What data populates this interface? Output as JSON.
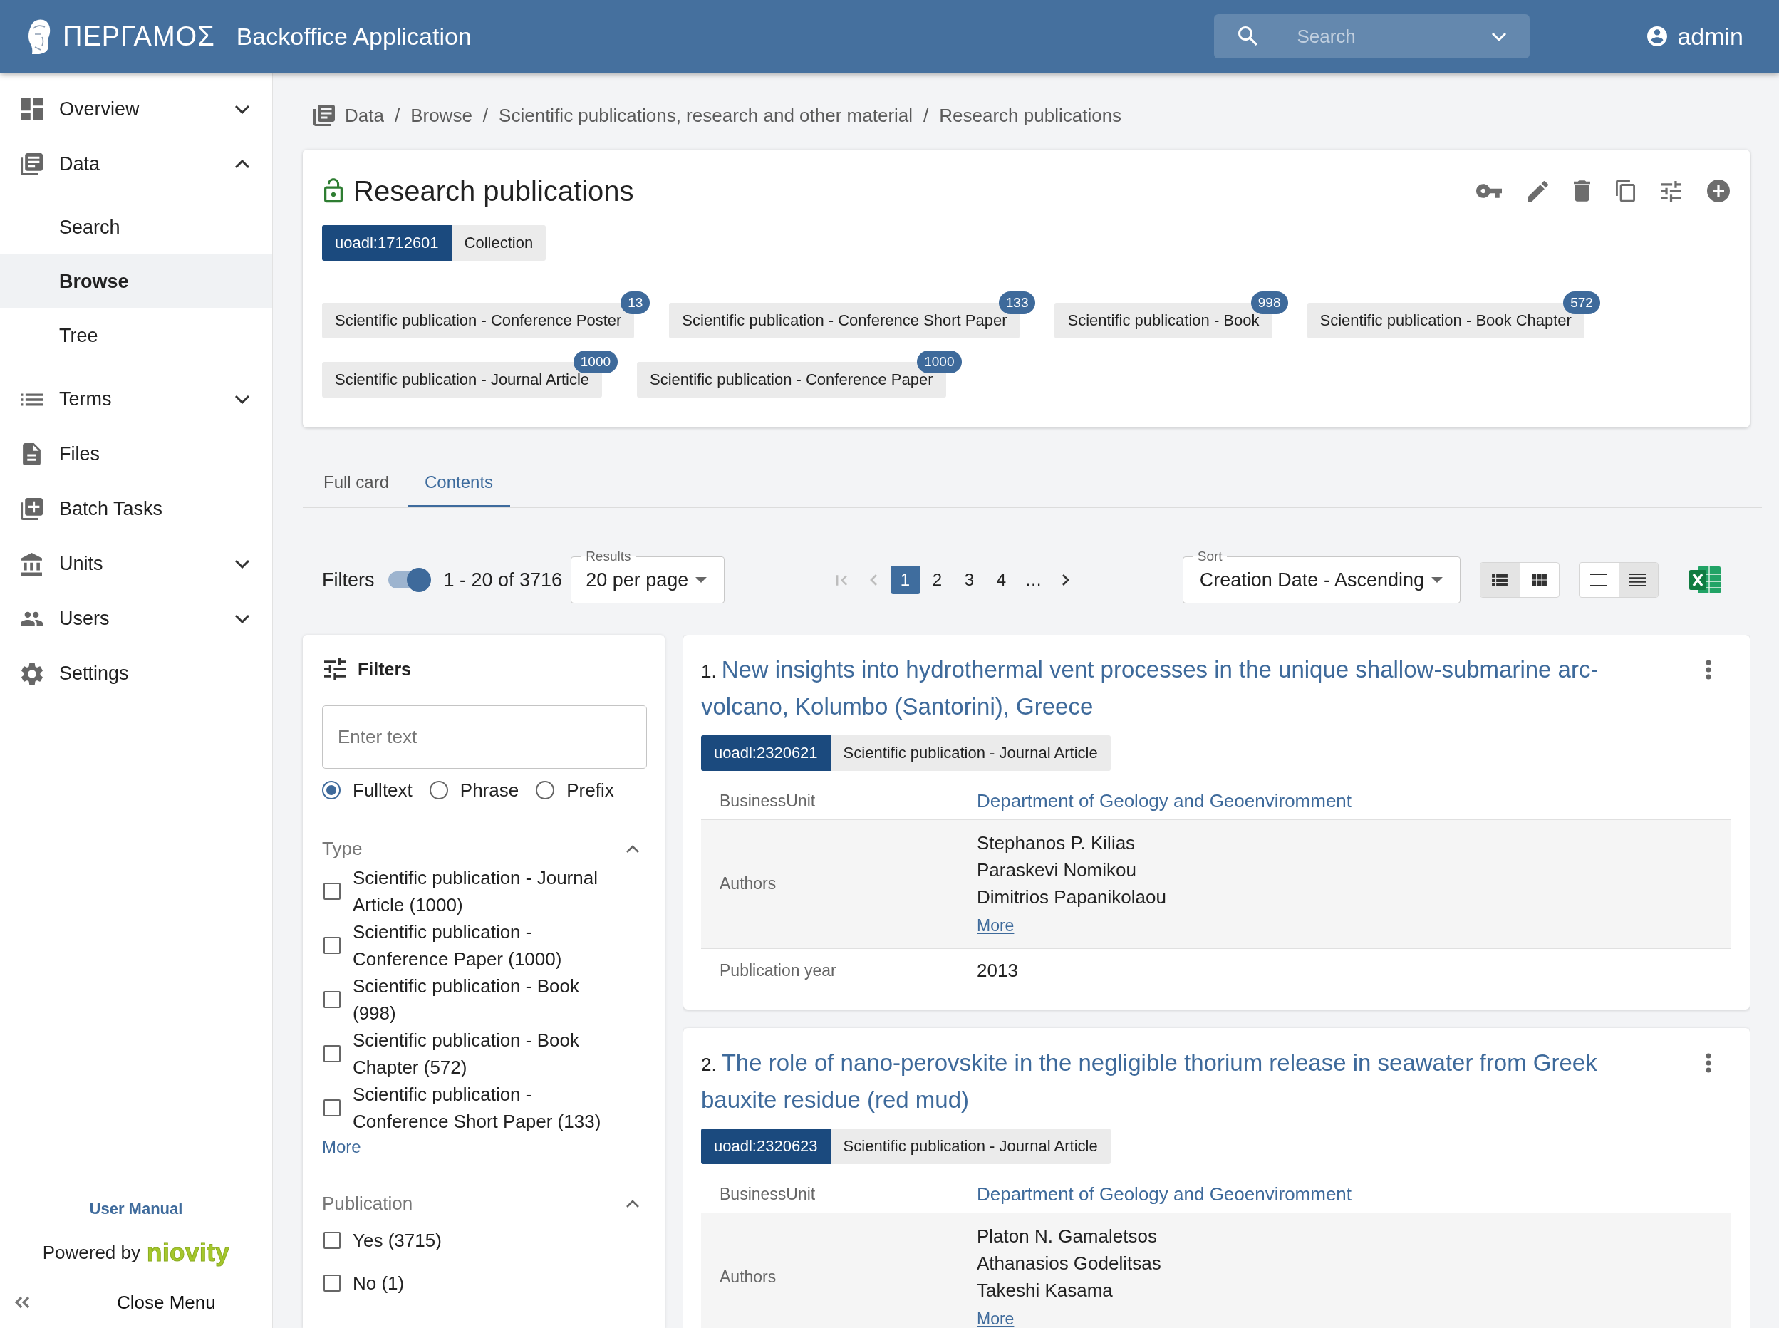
{
  "header": {
    "logo_text": "ΠΕΡΓΑΜΟΣ",
    "app_title": "Backoffice Application",
    "search": {
      "placeholder": "Search"
    },
    "user": "admin"
  },
  "sidebar": {
    "items": [
      {
        "label": "Overview",
        "expanded": false,
        "selected": false
      },
      {
        "label": "Data",
        "expanded": true,
        "selected": false,
        "children": [
          {
            "label": "Search",
            "selected": false
          },
          {
            "label": "Browse",
            "selected": true
          },
          {
            "label": "Tree",
            "selected": false
          }
        ]
      },
      {
        "label": "Terms",
        "expanded": false,
        "selected": false
      },
      {
        "label": "Files",
        "selected": false
      },
      {
        "label": "Batch Tasks",
        "selected": false
      },
      {
        "label": "Units",
        "expanded": false,
        "selected": false
      },
      {
        "label": "Users",
        "expanded": false,
        "selected": false
      },
      {
        "label": "Settings",
        "selected": false
      }
    ],
    "footer": {
      "manual_link": "User Manual",
      "powered_by": "Powered by",
      "brand": "niovity",
      "close_menu": "Close Menu"
    }
  },
  "breadcrumb": {
    "items": [
      "Data",
      "Browse",
      "Scientific publications, research and other material",
      "Research publications"
    ],
    "separator": "/"
  },
  "record": {
    "locked": false,
    "title": "Research publications",
    "id": "uoadl:1712601",
    "type": "Collection",
    "type_counts": [
      {
        "label": "Scientific publication - Conference Poster",
        "count": "13"
      },
      {
        "label": "Scientific publication - Conference Short Paper",
        "count": "133"
      },
      {
        "label": "Scientific publication - Book",
        "count": "998"
      },
      {
        "label": "Scientific publication - Book Chapter",
        "count": "572"
      },
      {
        "label": "Scientific publication - Journal Article",
        "count": "1000"
      },
      {
        "label": "Scientific publication - Conference Paper",
        "count": "1000"
      }
    ]
  },
  "tabs": [
    {
      "label": "Full card",
      "selected": false
    },
    {
      "label": "Contents",
      "selected": true
    }
  ],
  "toolbar": {
    "filters_label": "Filters",
    "filters_on": true,
    "range": "1 - 20 of 3716",
    "page_size": {
      "label": "Results",
      "value": "20 per page"
    },
    "pagination": {
      "first": {
        "disabled": true
      },
      "previous": {
        "disabled": true
      },
      "pages": [
        {
          "label": "1",
          "selected": true
        },
        {
          "label": "2",
          "selected": false
        },
        {
          "label": "3",
          "selected": false
        },
        {
          "label": "4",
          "selected": false
        }
      ],
      "gap": "…",
      "next": {
        "disabled": false
      }
    },
    "sort": {
      "label": "Sort",
      "value": "Creation Date - Ascending"
    },
    "view_modes": [
      {
        "kind": "list",
        "selected": true
      },
      {
        "kind": "grid",
        "selected": false
      }
    ],
    "density_modes": [
      {
        "kind": "compact",
        "selected": false
      },
      {
        "kind": "comfortable",
        "selected": true
      }
    ]
  },
  "filters": {
    "title": "Filters",
    "search": {
      "placeholder": "Enter text"
    },
    "modes": [
      {
        "label": "Fulltext",
        "selected": true
      },
      {
        "label": "Phrase",
        "selected": false
      },
      {
        "label": "Prefix",
        "selected": false
      }
    ],
    "facets": [
      {
        "title": "Type",
        "expanded": true,
        "options": [
          {
            "label": "Scientific publication - Journal Article (1000)",
            "checked": false
          },
          {
            "label": "Scientific publication - Conference Paper (1000)",
            "checked": false
          },
          {
            "label": "Scientific publication - Book (998)",
            "checked": false
          },
          {
            "label": "Scientific publication - Book Chapter (572)",
            "checked": false
          },
          {
            "label": "Scientific publication - Conference Short Paper (133)",
            "checked": false
          }
        ],
        "more": "More"
      },
      {
        "title": "Publication",
        "expanded": true,
        "options": [
          {
            "label": "Yes (3715)",
            "checked": false
          },
          {
            "label": "No (1)",
            "checked": false
          }
        ]
      }
    ]
  },
  "results": [
    {
      "number": "1.",
      "title": "New insights into hydrothermal vent processes in the unique shallow-submarine arc-volcano, Kolumbo (Santorini), Greece",
      "id": "uoadl:2320621",
      "type": "Scientific publication - Journal Article",
      "fields": [
        {
          "kind": "link",
          "label": "BusinessUnit",
          "values": [
            "Department of Geology and Geoenviromment"
          ]
        },
        {
          "kind": "list",
          "label": "Authors",
          "values": [
            "Stephanos P. Kilias",
            "Paraskevi Nomikou",
            "Dimitrios Papanikolaou"
          ],
          "more": "More"
        },
        {
          "kind": "text",
          "label": "Publication year",
          "values": [
            "2013"
          ]
        }
      ]
    },
    {
      "number": "2.",
      "title": "The role of nano-perovskite in the negligible thorium release in seawater from Greek bauxite residue (red mud)",
      "id": "uoadl:2320623",
      "type": "Scientific publication - Journal Article",
      "fields": [
        {
          "kind": "link",
          "label": "BusinessUnit",
          "values": [
            "Department of Geology and Geoenviromment"
          ]
        },
        {
          "kind": "list",
          "label": "Authors",
          "values": [
            "Platon N. Gamaletsos",
            "Athanasios Godelitsas",
            "Takeshi Kasama"
          ],
          "more": "More"
        }
      ]
    }
  ]
}
